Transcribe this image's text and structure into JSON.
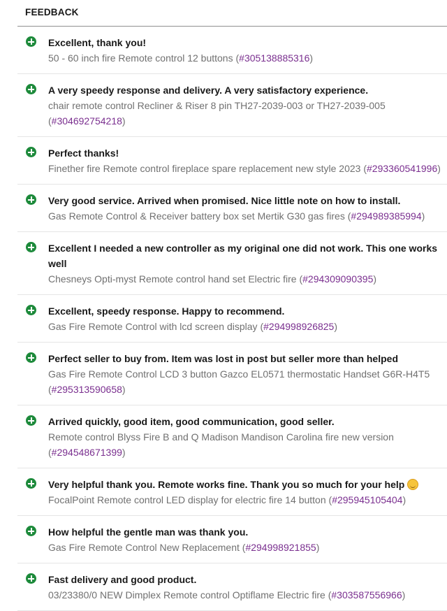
{
  "header": {
    "title": "FEEDBACK"
  },
  "feedback": [
    {
      "comment": "Excellent, thank you!",
      "product": "50 - 60 inch fire Remote control 12 buttons",
      "item_id": "#305138885316"
    },
    {
      "comment": "A very speedy response and delivery. A very satisfactory experience.",
      "product": "chair remote control Recliner & Riser 8 pin TH27-2039-003 or TH27-2039-005",
      "item_id": "#304692754218"
    },
    {
      "comment": "Perfect thanks!",
      "product": "Finether fire Remote control fireplace spare replacement new style 2023",
      "item_id": "#293360541996"
    },
    {
      "comment": "Very good service. Arrived when promised. Nice little note on how to install.",
      "product": "Gas Remote Control & Receiver battery box set Mertik G30 gas fires",
      "item_id": "#294989385994"
    },
    {
      "comment": "Excellent I needed a new controller as my original one did not work. This one works well",
      "product": "Chesneys Opti-myst Remote control hand set Electric fire",
      "item_id": "#294309090395"
    },
    {
      "comment": "Excellent, speedy response. Happy to recommend.",
      "product": "Gas Fire Remote Control with lcd screen display",
      "item_id": "#294998926825"
    },
    {
      "comment": "Perfect seller to buy from. Item was lost in post but seller more than helped",
      "product": "Gas Fire Remote Control LCD 3 button Gazco EL0571 thermostatic Handset G6R-H4T5",
      "item_id": "#295313590658"
    },
    {
      "comment": "Arrived quickly, good item, good communication, good seller.",
      "product": "Remote control Blyss Fire B and Q Madison Mandison Carolina fire new version",
      "item_id": "#294548671399"
    },
    {
      "comment": "Very helpful thank you. Remote works fine. Thank you so much for your help",
      "emoji": "smiling-face-with-smiling-eyes",
      "product": "FocalPoint Remote control LED display for electric fire 14 button",
      "item_id": "#295945105404"
    },
    {
      "comment": "How helpful the gentle man was thank you.",
      "product": "Gas Fire Remote Control New Replacement",
      "item_id": "#294998921855"
    },
    {
      "comment": "Fast delivery and good product.",
      "product": "03/23380/0 NEW Dimplex Remote control Optiflame Electric fire",
      "item_id": "#303587556966"
    }
  ],
  "colors": {
    "positive_icon": "#1d8a3b",
    "item_link": "#7a2f8f",
    "product_text": "#707070"
  },
  "icons": {
    "rating": "plus-circle-icon"
  }
}
